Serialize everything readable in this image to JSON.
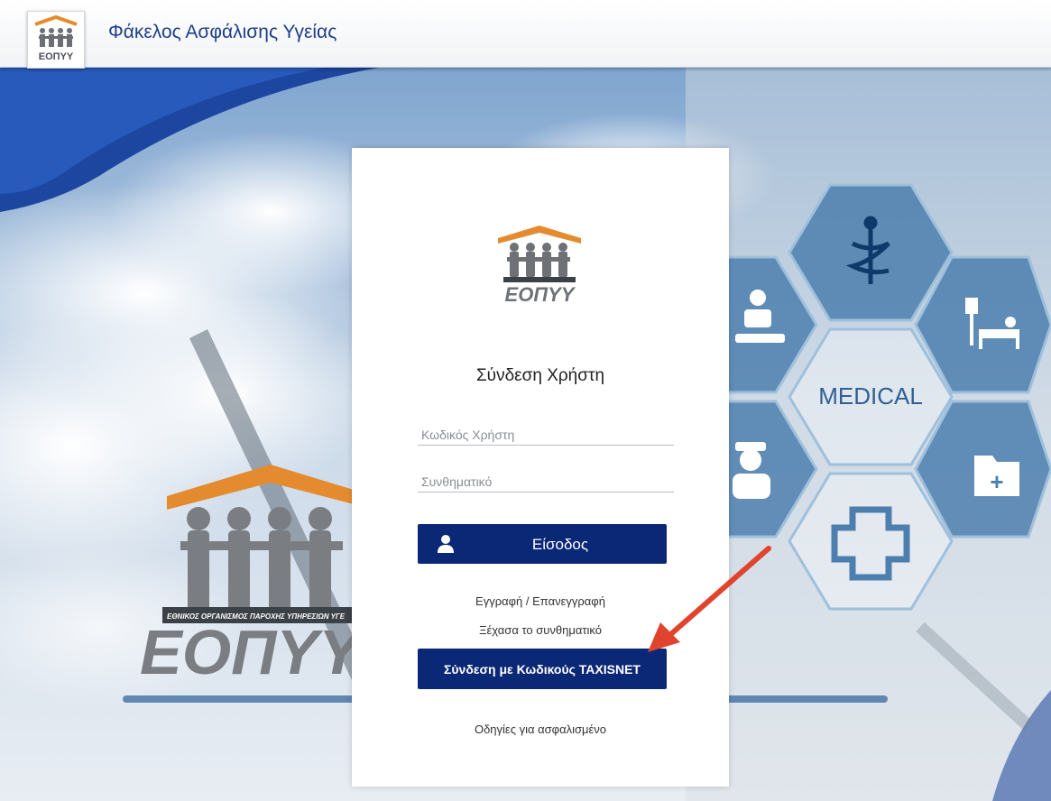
{
  "header": {
    "title": "Φάκελος Ασφάλισης Υγείας",
    "logo_text": "ΕΟΠΥΥ"
  },
  "card": {
    "logo_text": "ΕΟΠΥΥ",
    "title": "Σύνδεση Χρήστη",
    "username_placeholder": "Κωδικός Χρήστη",
    "password_placeholder": "Συνθηματικό",
    "login_button": "Είσοδος",
    "register_link": "Εγγραφή / Επανεγγραφή",
    "forgot_link": "Ξέχασα το συνθηματικό",
    "taxisnet_button": "Σύνδεση με Κωδικούς TAXISNET",
    "guide_link": "Οδηγίες για ασφαλισμένο"
  },
  "background": {
    "big_logo_text": "ΕΟΠΥΥ",
    "big_logo_subtitle": "ΕΘΝΙΚΟΣ ΟΡΓΑΝΙΣΜΟΣ ΠΑΡΟΧΗΣ ΥΠΗΡΕΣΙΩΝ ΥΓΕ",
    "medical_label": "MEDICAL"
  },
  "colors": {
    "primary": "#0b2876",
    "header_title": "#1d3f8a",
    "logo_orange": "#e58b2f",
    "hex_blue": "#4c7fae",
    "arrow_red": "#e0442e"
  },
  "icons": [
    "user-icon",
    "caduceus-icon",
    "patient-bed-icon",
    "doctor-icon",
    "hospital-bed-icon",
    "folder-plus-icon",
    "medical-cross-icon"
  ]
}
